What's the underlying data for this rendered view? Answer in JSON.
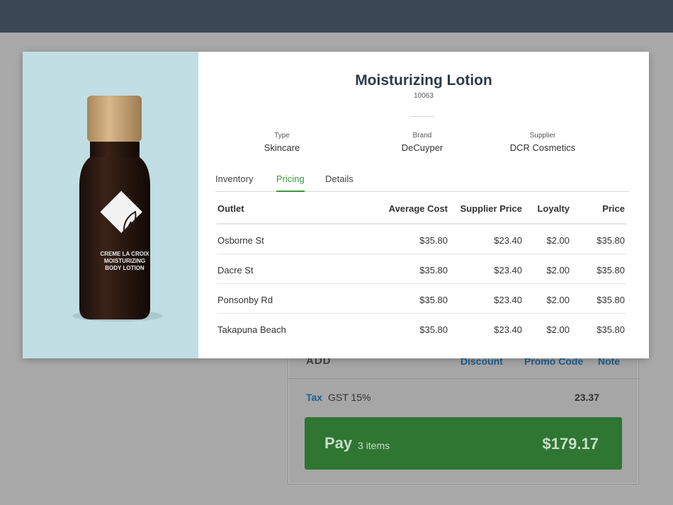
{
  "colors": {
    "topbar": "#3b4754",
    "accent_green": "#3e9a3e",
    "pay_button": "#2e7631",
    "link_blue": "#1d5f8f"
  },
  "product": {
    "title": "Moisturizing Lotion",
    "sku": "10063",
    "image_label": "CREME LA CROIX MOISTURIZING BODY LOTION",
    "attributes": [
      {
        "label": "Type",
        "value": "Skincare"
      },
      {
        "label": "Brand",
        "value": "DeCuyper"
      },
      {
        "label": "Supplier",
        "value": "DCR Cosmetics"
      }
    ]
  },
  "tabs": [
    {
      "label": "Inventory",
      "active": false
    },
    {
      "label": "Pricing",
      "active": true
    },
    {
      "label": "Details",
      "active": false
    }
  ],
  "pricing_table": {
    "headers": {
      "outlet": "Outlet",
      "average_cost": "Average Cost",
      "supplier_price": "Supplier Price",
      "loyalty": "Loyalty",
      "price": "Price"
    },
    "rows": [
      {
        "outlet": "Osborne St",
        "average_cost": "$35.80",
        "supplier_price": "$23.40",
        "loyalty": "$2.00",
        "price": "$35.80"
      },
      {
        "outlet": "Dacre St",
        "average_cost": "$35.80",
        "supplier_price": "$23.40",
        "loyalty": "$2.00",
        "price": "$35.80"
      },
      {
        "outlet": "Ponsonby Rd",
        "average_cost": "$35.80",
        "supplier_price": "$23.40",
        "loyalty": "$2.00",
        "price": "$35.80"
      },
      {
        "outlet": "Takapuna Beach",
        "average_cost": "$35.80",
        "supplier_price": "$23.40",
        "loyalty": "$2.00",
        "price": "$35.80"
      }
    ]
  },
  "sale": {
    "add_label": "ADD",
    "discount_label": "Discount",
    "promo_label": "Promo Code",
    "note_label": "Note",
    "tax_link": "Tax",
    "tax_name": "GST 15%",
    "tax_amount": "23.37",
    "pay_label": "Pay",
    "pay_items": "3 items",
    "pay_total": "$179.17"
  }
}
